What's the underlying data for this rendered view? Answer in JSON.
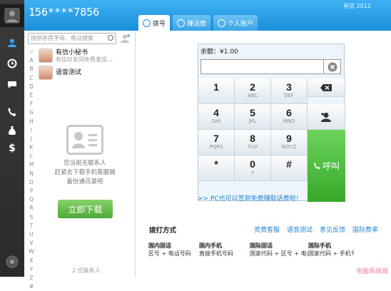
{
  "header": {
    "phone": "156****7856",
    "brand": "有信 2012",
    "tabs": [
      {
        "label": "拨号",
        "icon": "phone-icon"
      },
      {
        "label": "赚话费",
        "icon": "moneybag-icon"
      },
      {
        "label": "个人账户",
        "icon": "dollar-icon"
      }
    ]
  },
  "rail": {
    "icons": [
      "logo-icon",
      "person-icon",
      "history-icon",
      "chat-icon",
      "call-icon",
      "moneybag-icon",
      "dollar-icon",
      "settings-icon"
    ]
  },
  "contacts": {
    "search_placeholder": "按拼音首字母、电话搜索",
    "alphabet": [
      "☆",
      "A",
      "B",
      "C",
      "D",
      "E",
      "F",
      "G",
      "H",
      "I",
      "J",
      "K",
      "L",
      "M",
      "N",
      "O",
      "P",
      "Q",
      "R",
      "S",
      "T",
      "U",
      "V",
      "W",
      "X",
      "Y",
      "Z",
      "#"
    ],
    "items": [
      {
        "name": "有信小秘书",
        "message": "有信好友间免费发信..."
      },
      {
        "name": "语音测试",
        "message": ""
      }
    ],
    "empty_lines": [
      "您当前无联系人",
      "赶紧去下载手机客服端",
      "备份通讯录吧"
    ],
    "download_label": "立即下载",
    "count": "2 位联系人"
  },
  "dialpad": {
    "balance": "余额：¥1.00",
    "number_value": "",
    "keys": [
      {
        "digit": "1",
        "letters": ""
      },
      {
        "digit": "2",
        "letters": "ABC"
      },
      {
        "digit": "3",
        "letters": "DEF"
      },
      {
        "digit": "4",
        "letters": "GHI"
      },
      {
        "digit": "5",
        "letters": "JKL"
      },
      {
        "digit": "6",
        "letters": "MNO"
      },
      {
        "digit": "7",
        "letters": "PQRS"
      },
      {
        "digit": "8",
        "letters": "TUV"
      },
      {
        "digit": "9",
        "letters": "WXYZ"
      },
      {
        "digit": "*",
        "letters": ""
      },
      {
        "digit": "0",
        "letters": "+"
      },
      {
        "digit": "#",
        "letters": ""
      }
    ],
    "call_label": "呼叫",
    "promo": ">> PC也可以签到免费赚取话费啦！"
  },
  "bottom": {
    "title": "拨打方式",
    "links": [
      "资费客服",
      "语音测试",
      "意见反馈",
      "国际费率"
    ],
    "methods": [
      {
        "title": "国内固话",
        "desc": "区号 + 电话号码"
      },
      {
        "title": "国内手机",
        "desc": "直拨手机号码"
      },
      {
        "title": "国际固话",
        "desc": "国家代码 + 区号 + 电话号码"
      },
      {
        "title": "国际手机",
        "desc": "国家代码 + 手机号"
      }
    ]
  },
  "watermark": "电脑系统城",
  "colors": {
    "header": "#1b8fdc",
    "rail": "#2f2f2f",
    "call": "#3cb02e",
    "link": "#2a87cf"
  }
}
